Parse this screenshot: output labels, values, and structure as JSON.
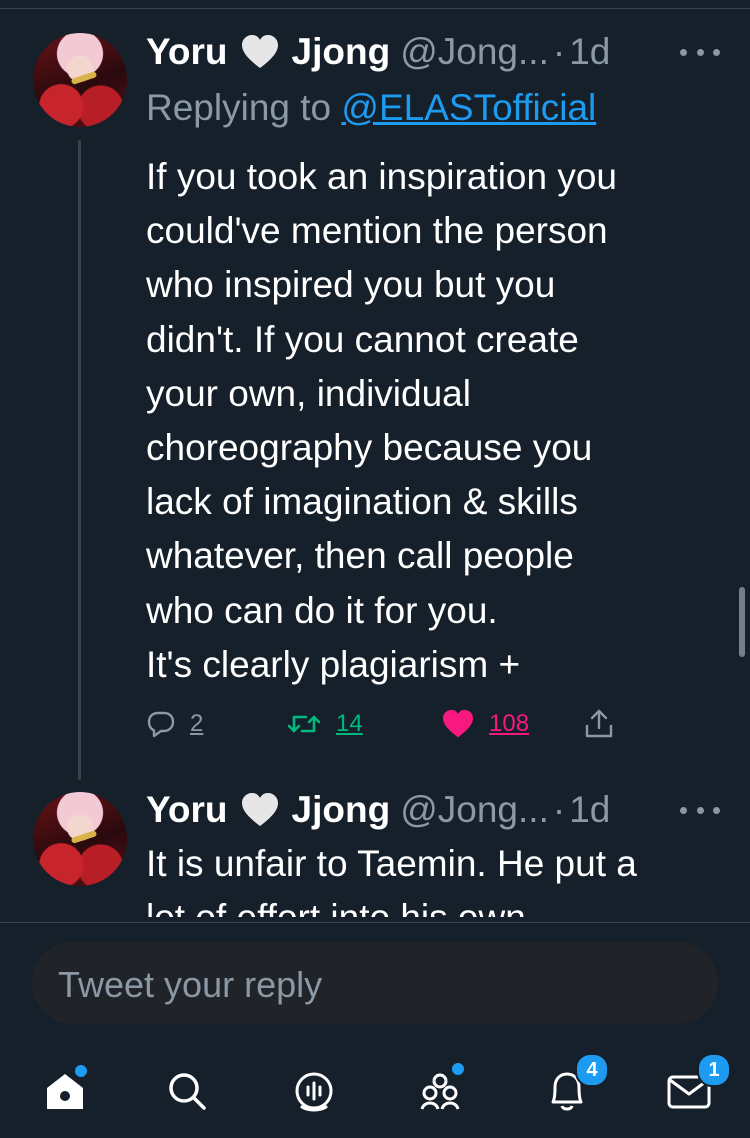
{
  "tweets": [
    {
      "name": "Yoru",
      "name_suffix": "Jjong",
      "handle": "@Jong...",
      "dot": "·",
      "time": "1d",
      "replying_prefix": "Replying to ",
      "replying_to": "@ELASTofficial",
      "text": "If you took an inspiration you\ncould've mention the person\nwho inspired you but you\ndidn't. If you cannot create\nyour own, individual\nchoreography because you\nlack of imagination & skills\nwhatever, then call people\nwho can do it for you.\nIt's clearly plagiarism +",
      "replies": "2",
      "retweets": "14",
      "likes": "108"
    },
    {
      "name": "Yoru",
      "name_suffix": "Jjong",
      "handle": "@Jong...",
      "dot": "·",
      "time": "1d",
      "text": "It is unfair to Taemin. He put a\nlot of effort into his own"
    }
  ],
  "composer": {
    "placeholder": "Tweet your reply"
  },
  "nav": {
    "items": [
      {
        "icon": "home-icon",
        "dot": true
      },
      {
        "icon": "search-icon"
      },
      {
        "icon": "spaces-icon"
      },
      {
        "icon": "communities-icon",
        "dot": true
      },
      {
        "icon": "notifications-icon",
        "badge": "4"
      },
      {
        "icon": "messages-icon",
        "badge": "1"
      }
    ]
  },
  "colors": {
    "background": "#15202b",
    "accent": "#1d9bf0",
    "secondary_text": "#8b98a5",
    "retweet": "#00ba7c",
    "like": "#f91880"
  }
}
